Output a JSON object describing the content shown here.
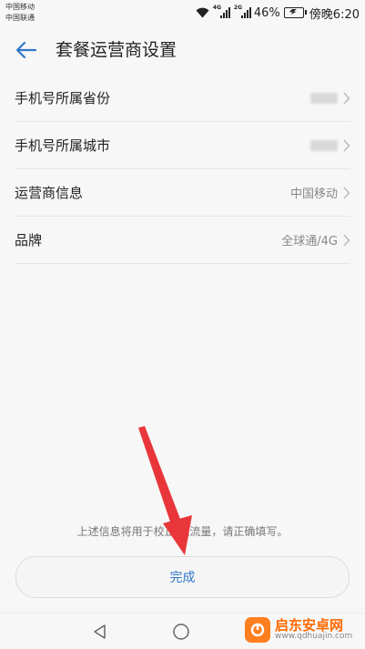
{
  "status_bar": {
    "carrier1": "中国移动",
    "carrier2": "中国联通",
    "net1": "4G",
    "net2": "2G",
    "battery": "46%",
    "time": "傍晚6:20"
  },
  "header": {
    "title": "套餐运营商设置"
  },
  "list": {
    "items": [
      {
        "label": "手机号所属省份",
        "value": ""
      },
      {
        "label": "手机号所属城市",
        "value": ""
      },
      {
        "label": "运营商信息",
        "value": "中国移动"
      },
      {
        "label": "品牌",
        "value": "全球通/4G"
      }
    ]
  },
  "footer": {
    "note": "上述信息将用于校正 据流量，请正确填写。",
    "done_label": "完成"
  },
  "watermark": {
    "name": "启东安卓网",
    "url": "www.qdhuajin.com"
  },
  "colors": {
    "accent": "#2f78c8",
    "arrow": "#e8363a",
    "watermark": "#ff6a00"
  }
}
